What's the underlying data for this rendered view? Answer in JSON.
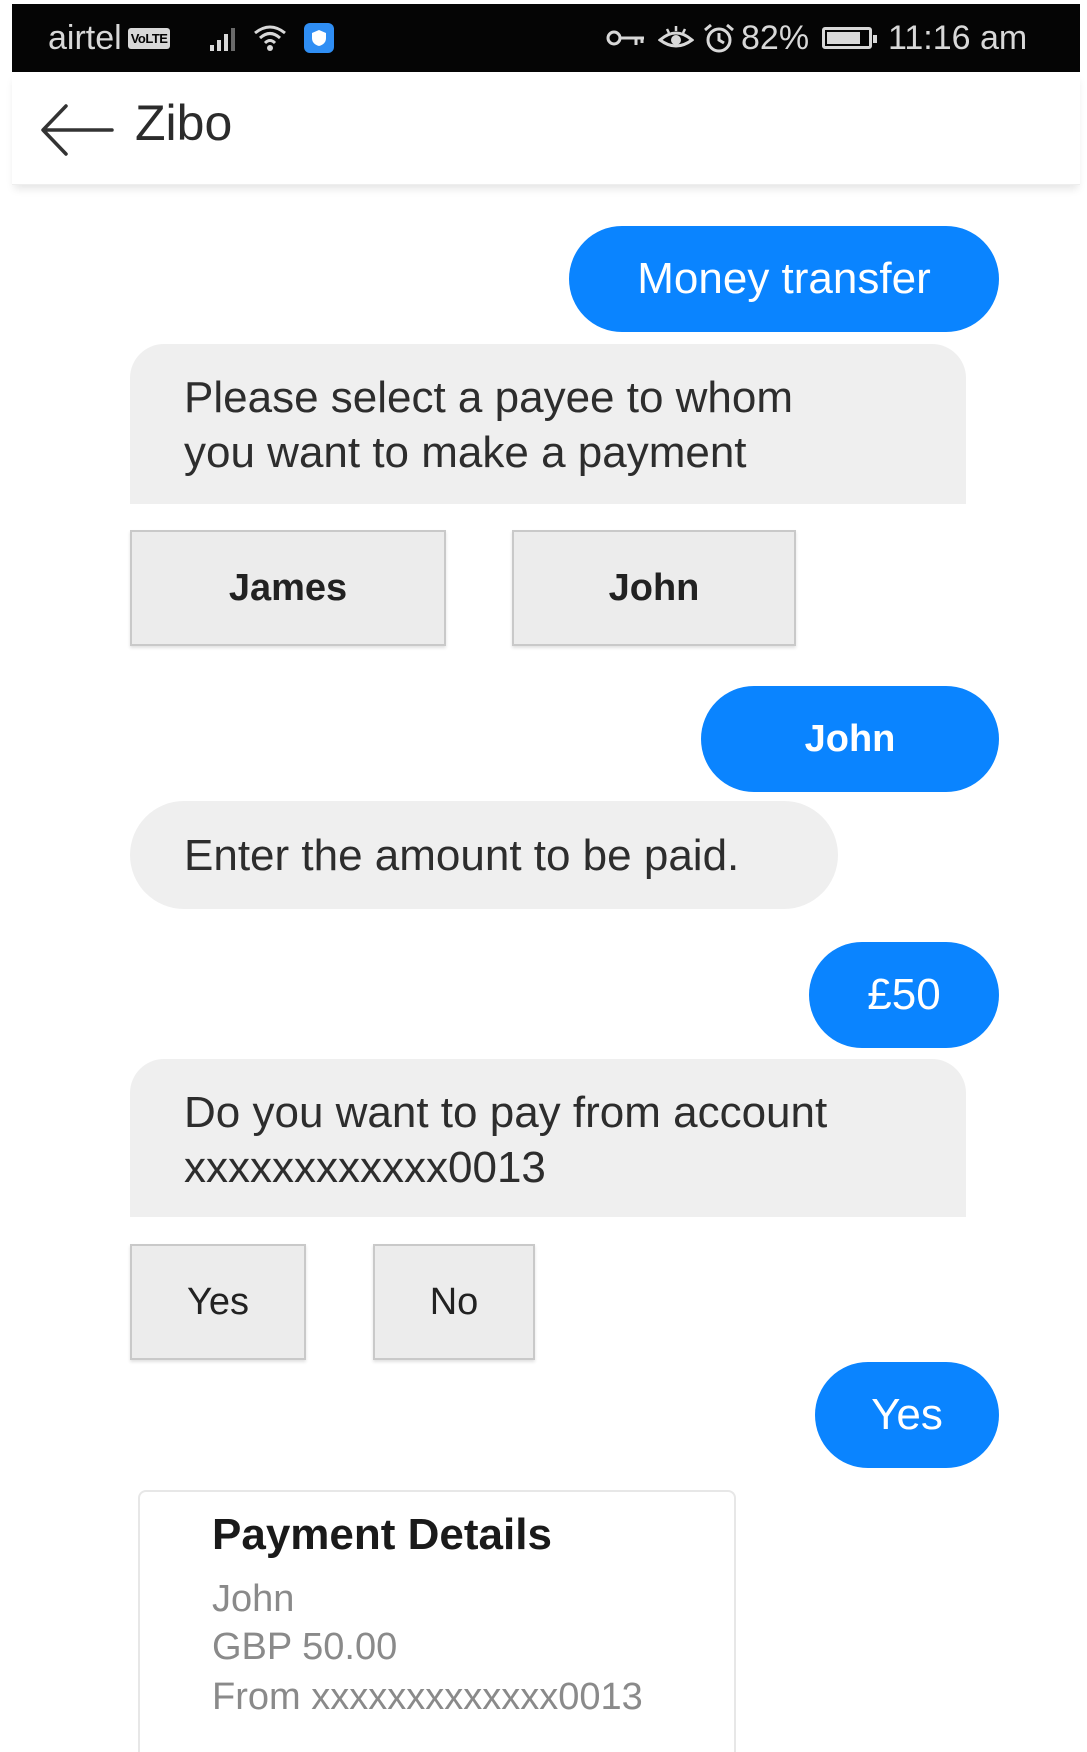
{
  "status_bar": {
    "carrier": "airtel",
    "volte_badge": "VoLTE",
    "battery_percent": "82%",
    "battery_level": 0.82,
    "time": "11:16 am",
    "icons": [
      "signal-icon",
      "wifi-icon",
      "shield-icon",
      "vpn-key-icon",
      "eye-icon",
      "alarm-icon",
      "battery-icon"
    ]
  },
  "app_bar": {
    "title": "Zibo",
    "back_icon": "arrow-left-icon"
  },
  "colors": {
    "user_bubble": "#0a84ff",
    "bot_bubble": "#efefef",
    "option_button": "#ececec",
    "status_bar": "#050505"
  },
  "conversation": {
    "msg1_user": "Money transfer",
    "msg2_bot_line1": "Please select a payee to whom",
    "msg2_bot_line2": "you want to make a payment",
    "payee_options": [
      "James",
      "John"
    ],
    "msg3_user": "John",
    "msg4_bot": "Enter the amount to be paid.",
    "msg5_user": "£50",
    "msg6_bot_line1": "Do you want to pay from account",
    "msg6_bot_line2": "xxxxxxxxxxxx0013",
    "confirm_options": [
      "Yes",
      "No"
    ],
    "msg7_user": "Yes"
  },
  "payment_card": {
    "title": "Payment Details",
    "payee": "John",
    "amount": "GBP 50.00",
    "from_account": "From xxxxxxxxxxxxx0013"
  }
}
